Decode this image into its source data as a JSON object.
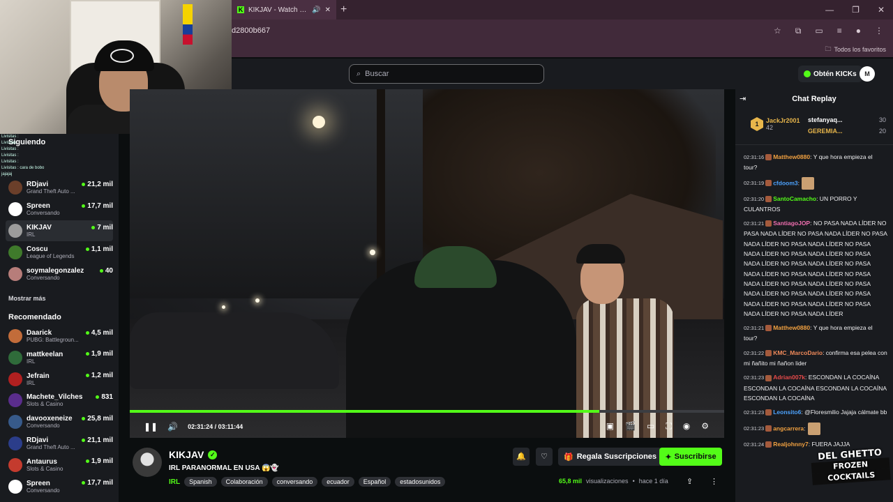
{
  "browser": {
    "tab_title": "KIKJAV - Watch the VOD on",
    "favicon": "K",
    "url": "d2800b667",
    "bookmarks_label": "Todos los favoritos"
  },
  "header": {
    "search_placeholder": "Buscar",
    "kicks_label": "Obtén KICKs",
    "user_initial": "M"
  },
  "webcam_chat": [
    "Livisitas :",
    "Livisitas :",
    "Livisitas :",
    "Livisitas :",
    "Livisitas :",
    "Livisitas : cara de bobo jajajaj"
  ],
  "sidebar": {
    "following_title": "Siguiendo",
    "following": [
      {
        "name": "RDjavi",
        "category": "Grand Theft Auto ...",
        "viewers": "21,2 mil",
        "color": "#6b3f2a"
      },
      {
        "name": "Spreen",
        "category": "Conversando",
        "viewers": "17,7 mil",
        "color": "#ffffff"
      },
      {
        "name": "KIKJAV",
        "category": "IRL",
        "viewers": "7 mil",
        "color": "#9c9c9c"
      },
      {
        "name": "Coscu",
        "category": "League of Legends",
        "viewers": "1,1 mil",
        "color": "#3f7a2b"
      },
      {
        "name": "soymalegonzalez",
        "category": "Conversando",
        "viewers": "40",
        "color": "#b77d7a"
      }
    ],
    "show_more": "Mostrar más",
    "recommended_title": "Recomendado",
    "recommended": [
      {
        "name": "Daarick",
        "category": "PUBG: Battlegroun...",
        "viewers": "4,5 mil",
        "color": "#c26c3a"
      },
      {
        "name": "mattkeelan",
        "category": "IRL",
        "viewers": "1,9 mil",
        "color": "#2f6b3a"
      },
      {
        "name": "Jefrain",
        "category": "IRL",
        "viewers": "1,2 mil",
        "color": "#b02020"
      },
      {
        "name": "Machete_Vilches",
        "category": "Slots & Casino",
        "viewers": "831",
        "color": "#5a2d8c"
      },
      {
        "name": "davooxeneize",
        "category": "Conversando",
        "viewers": "25,8 mil",
        "color": "#375a8a"
      },
      {
        "name": "RDjavi",
        "category": "Grand Theft Auto ...",
        "viewers": "21,1 mil",
        "color": "#2b3d8a"
      },
      {
        "name": "Antaurus",
        "category": "Slots & Casino",
        "viewers": "1,9 mil",
        "color": "#c43b2e"
      },
      {
        "name": "Spreen",
        "category": "Conversando",
        "viewers": "17,7 mil",
        "color": "#ffffff"
      }
    ]
  },
  "player": {
    "current_time": "02:31:24",
    "separator": "/",
    "duration": "03:11:44",
    "progress": 0.79
  },
  "stream": {
    "channel": "KIKJAV",
    "title": "IRL PARANORMAL EN USA 😱👻",
    "category": "IRL",
    "tags": [
      "Spanish",
      "Colaboración",
      "conversando",
      "ecuador",
      "Español",
      "estadosunidos"
    ],
    "gift_label": "Regala Suscripciones",
    "subscribe_label": "Suscribirse",
    "views_num": "65,8 mil",
    "views_label": "visualizaciones",
    "dot": "•",
    "ago": "hace 1 día"
  },
  "chat": {
    "title": "Chat Replay",
    "leaderboard": {
      "first": {
        "rank": "1",
        "name": "JackJr2001",
        "value": "42"
      },
      "others": [
        {
          "name": "stefanyaq...",
          "value": "30"
        },
        {
          "name": "GEREMIA...",
          "value": "20"
        }
      ]
    },
    "messages": [
      {
        "time": "02:31:16",
        "user": "Matthew0880",
        "color": "#f0a040",
        "text": ": Y que hora empieza el tour?"
      },
      {
        "time": "02:31:19",
        "user": "cfdoom3",
        "color": "#4da3ff",
        "text": ":"
      },
      {
        "time": "02:31:20",
        "user": "SantoCamacho",
        "color": "#53fc18",
        "text": ": UN PORRO Y CULANTROS"
      },
      {
        "time": "02:31:21",
        "user": "SantiagoJOP",
        "color": "#f06fb0",
        "text": ": NO PASA NADA LÍDER NO PASA NADA LÍDER NO PASA NADA LÍDER NO PASA NADA LÍDER NO PASA NADA LÍDER NO PASA NADA LÍDER NO PASA NADA LÍDER NO PASA NADA LÍDER NO PASA NADA LÍDER NO PASA NADA LÍDER NO PASA NADA LÍDER NO PASA NADA LÍDER NO PASA NADA LÍDER NO PASA NADA LÍDER NO PASA NADA LÍDER NO PASA NADA LÍDER NO PASA NADA LÍDER NO PASA NADA LÍDER NO PASA NADA LÍDER"
      },
      {
        "time": "02:31:21",
        "user": "Matthew0880",
        "color": "#f0a040",
        "text": ": Y que hora empieza el tour?"
      },
      {
        "time": "02:31:22",
        "user": "KMC_MarcoDario",
        "color": "#f08a5a",
        "text": ": confirma esa pelea con mi ñañito mi ñañon lider"
      },
      {
        "time": "02:31:23",
        "user": "Adrian007k",
        "color": "#e84a4a",
        "text": ": ESCONDAN LA COCAÍNA ESCONDAN LA COCAÍNA ESCONDAN LA COCAÍNA ESCONDAN LA COCAÍNA"
      },
      {
        "time": "02:31:23",
        "user": "Leonsito6",
        "color": "#4da3ff",
        "text": ": @Floresmilio Jajaja cálmate bb"
      },
      {
        "time": "02:31:23",
        "user": "angcarrera",
        "color": "#f0a040",
        "text": ":"
      },
      {
        "time": "02:31:24",
        "user": "Realjohnny7",
        "color": "#f0a040",
        "text": ": FUERA JAJJA"
      }
    ]
  },
  "watermark": {
    "line1": "DEL GHETTO",
    "line2": "FROZEN",
    "line3": "COCKTAILS"
  }
}
